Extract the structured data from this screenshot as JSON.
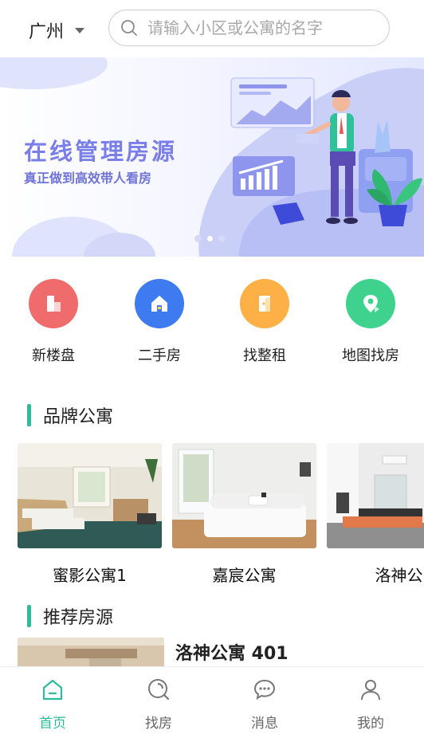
{
  "header": {
    "city": "广州",
    "search_placeholder": "请输入小区或公寓的名字"
  },
  "banner": {
    "title": "在线管理房源",
    "subtitle": "真正做到高效带人看房",
    "slide_count": 3,
    "active_slide": 2
  },
  "categories": [
    {
      "label": "新楼盘",
      "icon": "building-icon",
      "color": "#f06b6b"
    },
    {
      "label": "二手房",
      "icon": "house-icon",
      "color": "#3f7bf0"
    },
    {
      "label": "找整租",
      "icon": "door-icon",
      "color": "#fdb046"
    },
    {
      "label": "地图找房",
      "icon": "map-pin-icon",
      "color": "#3ed28e"
    }
  ],
  "brand_section": {
    "title": "品牌公寓",
    "items": [
      {
        "name": "蜜影公寓1"
      },
      {
        "name": "嘉宸公寓"
      },
      {
        "name": "洛神公"
      }
    ]
  },
  "recommend_section": {
    "title": "推荐房源",
    "items": [
      {
        "title": "洛神公寓 401"
      }
    ]
  },
  "tabbar": {
    "items": [
      {
        "label": "首页",
        "icon": "home-icon",
        "active": true
      },
      {
        "label": "找房",
        "icon": "find-house-icon",
        "active": false
      },
      {
        "label": "消息",
        "icon": "message-icon",
        "active": false
      },
      {
        "label": "我的",
        "icon": "profile-icon",
        "active": false
      }
    ]
  },
  "colors": {
    "accent": "#2dbb9a",
    "banner_text": "#7a7ee8"
  }
}
